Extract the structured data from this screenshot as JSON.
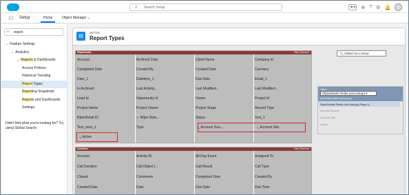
{
  "header": {
    "app_name": "Setup",
    "search_placeholder": "Search Setup",
    "icons": [
      "star-icon",
      "add-icon",
      "help-icon",
      "gear-icon",
      "bell-icon",
      "avatar"
    ]
  },
  "tabs": {
    "home": "Home",
    "object_manager": "Object Manager"
  },
  "sidebar": {
    "quick_find_value": "report",
    "tree": [
      {
        "label": "Feature Settings",
        "level": 0,
        "chev": "⌄"
      },
      {
        "label": "Analytics",
        "level": 1,
        "chev": "⌄"
      },
      {
        "label": "Reports & Dashboards",
        "level": 2,
        "chev": "⌄",
        "hl": "Reports"
      },
      {
        "label": "Access Policies",
        "level": 3
      },
      {
        "label": "Historical Trending",
        "level": 3
      },
      {
        "label": "Report Types",
        "level": 3,
        "selected": true,
        "hl": "Report"
      },
      {
        "label": "Reporting Snapshots",
        "level": 3,
        "hl": "Report"
      },
      {
        "label": "Reports and Dashboards",
        "level": 3,
        "hl": "Report"
      },
      {
        "label": "Settings",
        "level": 3
      }
    ],
    "hint": "Didn't find what you're looking for? Try using Global Search."
  },
  "page": {
    "breadcrumb": "SETUP",
    "title": "Report Types"
  },
  "section1": {
    "title": "RfpioDetails",
    "actions": "Edit | Remove",
    "columns": [
      [
        "Account",
        "Completed Date",
        "Date_1",
        "Is Archived",
        "Lead Id",
        "Project Name",
        "RfpioDetail ID",
        "Text_area_1"
      ],
      [
        "Archived Date",
        "Created By",
        "Datetime_1",
        "Last Activity...",
        "Opportunity Id",
        "Project Owner",
        "✓ Rfpio Deta...",
        "Type"
      ],
      [
        "Client Name",
        "Created Date",
        "Due Date",
        "Last Modified...",
        "Owner",
        "Project Stage",
        "Status",
        "🔍 Account Sou..."
      ],
      [
        "Company Id",
        "Currency",
        "Email_1",
        "Last Modified...",
        "Project Id",
        "Record Type",
        "Text_1",
        "🔍 Account Site"
      ]
    ],
    "extra": "🔍 Active"
  },
  "section2": {
    "title": "Activities",
    "actions": "Edit | Remove",
    "columns": [
      [
        "Account",
        "Call Duration",
        "Closed",
        "Created Date"
      ],
      [
        "Activity ID",
        "Call Object I...",
        "Comments",
        "Date"
      ],
      [
        "All-Day Event",
        "Call Result",
        "Completed Date",
        "Due Date"
      ],
      [
        "Assigned To",
        "Call Type",
        "Created By",
        "Due Time"
      ]
    ]
  },
  "right_panel": {
    "added_label": "Added via Lookup",
    "view_label": "View:",
    "view_value": "RfpioDetails Fields (via lookup) ▾",
    "view_sub": "Add fields related via lookup ▸",
    "items": [
      "RfpioDetails Fields (via lookup) (Page 1)",
      "Account Source",
      "Account Site",
      "Active"
    ]
  }
}
